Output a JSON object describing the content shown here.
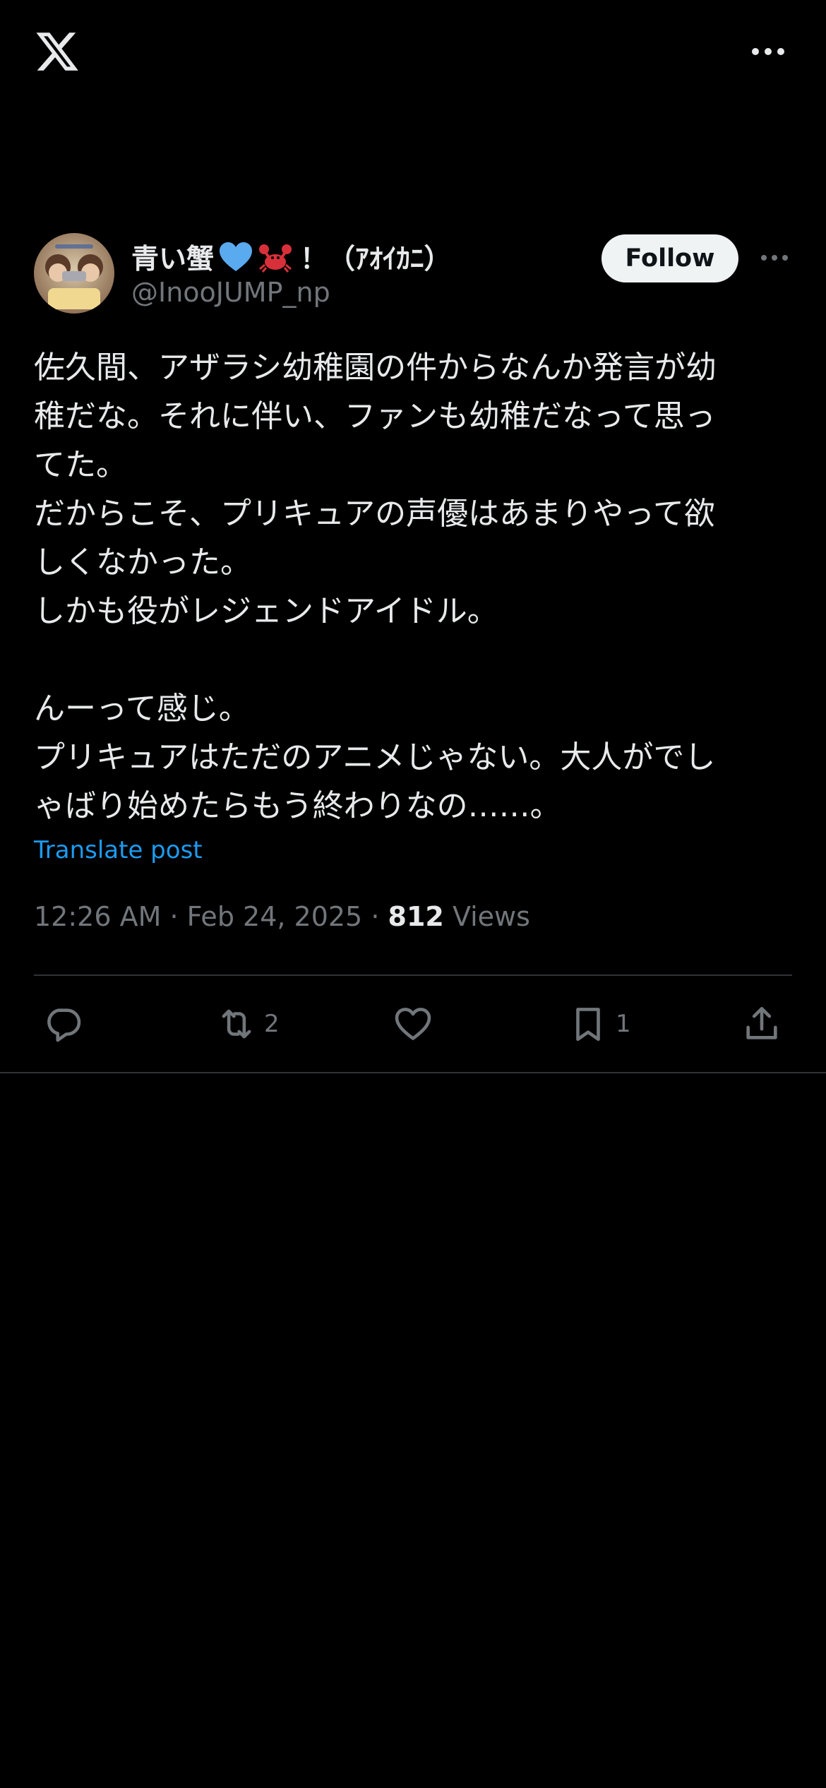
{
  "header": {
    "logo_icon": "x-logo-icon",
    "more_icon": "more-horizontal-icon"
  },
  "post": {
    "author": {
      "display_name_prefix": "青い蟹",
      "display_name_suffix": "！（ｱｵｲｶﾆ）",
      "emojis": [
        "blue-heart",
        "crab"
      ],
      "handle": "@InooJUMP_np"
    },
    "follow_label": "Follow",
    "text": "佐久間、アザラシ幼稚園の件からなんか発言が幼\n稚だな。それに伴い、ファンも幼稚だなって思っ\nてた。\nだからこそ、プリキュアの声優はあまりやって欲\nしくなかった。\nしかも役がレジェンドアイドル。\n\nんーって感じ。\nプリキュアはただのアニメじゃない。大人がでし\nゃばり始めたらもう終わりなの……。",
    "translate_label": "Translate post",
    "time": "12:26 AM",
    "separator": "·",
    "date": "Feb 24, 2025",
    "views_count": "812",
    "views_label": "Views"
  },
  "actions": {
    "reply": {
      "icon": "reply-icon",
      "count": ""
    },
    "repost": {
      "icon": "repost-icon",
      "count": "2"
    },
    "like": {
      "icon": "heart-icon",
      "count": ""
    },
    "bookmark": {
      "icon": "bookmark-icon",
      "count": "1"
    },
    "share": {
      "icon": "share-icon",
      "count": ""
    }
  },
  "colors": {
    "background": "#000000",
    "text": "#e7e9ea",
    "secondary": "#71767b",
    "link": "#1d9bf0",
    "divider": "#2f3336"
  }
}
